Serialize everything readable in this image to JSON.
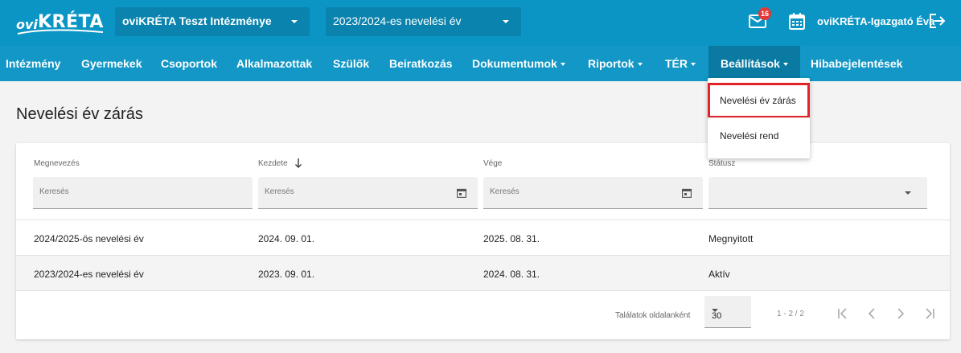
{
  "header": {
    "logo": {
      "ovi": "ovi",
      "kreta": "KRÉTA"
    },
    "institution_select": "oviKRÉTA Teszt Intézménye",
    "year_select": "2023/2024-es nevelési év",
    "mail_badge": "16",
    "user_name": "oviKRÉTA-Igazgató Éva"
  },
  "nav": {
    "items": [
      {
        "label": "Intézmény"
      },
      {
        "label": "Gyermekek"
      },
      {
        "label": "Csoportok"
      },
      {
        "label": "Alkalmazottak"
      },
      {
        "label": "Szülők"
      },
      {
        "label": "Beiratkozás"
      },
      {
        "label": "Dokumentumok"
      },
      {
        "label": "Riportok"
      },
      {
        "label": "TÉR"
      },
      {
        "label": "Beállítások"
      },
      {
        "label": "Hibabejelentések"
      }
    ]
  },
  "menu": {
    "items": [
      {
        "label": "Nevelési év zárás"
      },
      {
        "label": "Nevelési rend"
      }
    ]
  },
  "page": {
    "title": "Nevelési év zárás"
  },
  "table": {
    "columns": [
      "Megnevezés",
      "Kezdete",
      "Vége",
      "Státusz"
    ],
    "filter_placeholders": [
      "Keresés",
      "Keresés",
      "Keresés"
    ],
    "rows": [
      [
        "2024/2025-ös nevelési év",
        "2024. 09. 01.",
        "2025. 08. 31.",
        "Megnyitott"
      ],
      [
        "2023/2024-es nevelési év",
        "2023. 09. 01.",
        "2024. 08. 31.",
        "Aktív"
      ]
    ]
  },
  "pagination": {
    "per_page_label": "Találatok oldalanként",
    "per_page_value": "30",
    "range": "1 - 2 / 2"
  }
}
